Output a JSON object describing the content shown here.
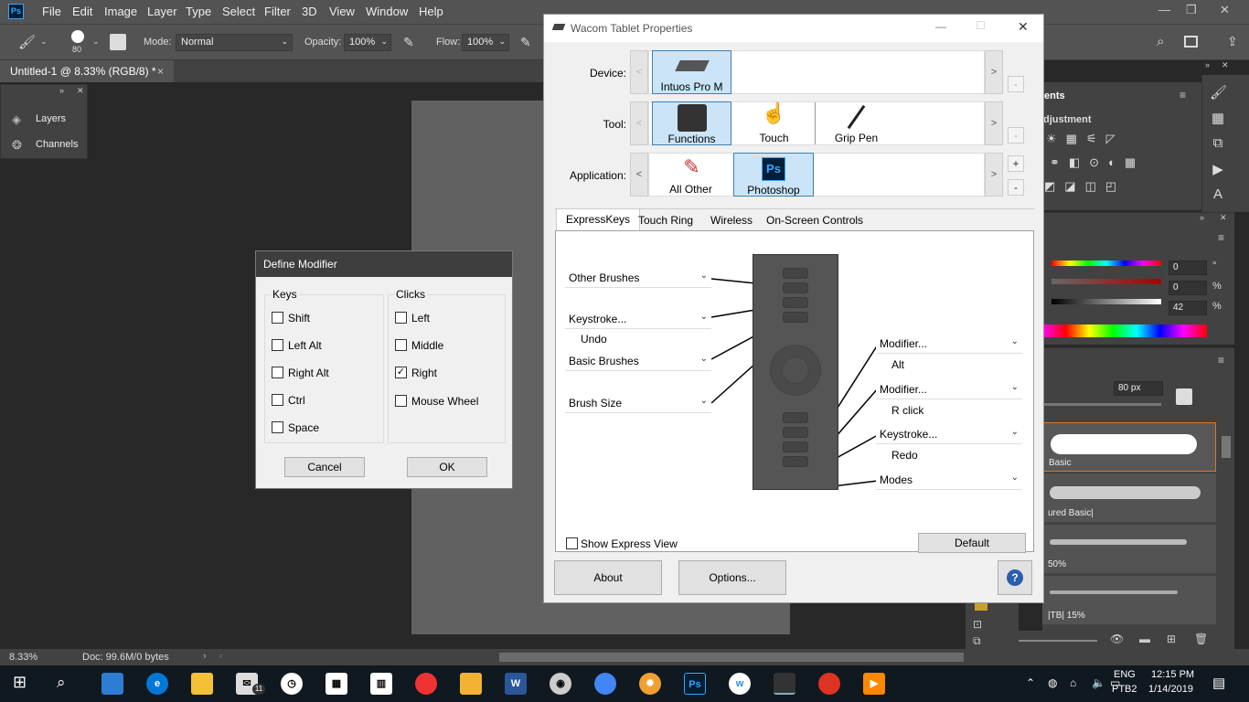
{
  "photoshop": {
    "menu": [
      "File",
      "Edit",
      "Image",
      "Layer",
      "Type",
      "Select",
      "Filter",
      "3D",
      "View",
      "Window",
      "Help"
    ],
    "logo": "Ps",
    "options": {
      "brush_size": "80",
      "mode_label": "Mode:",
      "mode_value": "Normal",
      "opacity_label": "Opacity:",
      "opacity_value": "100%",
      "flow_label": "Flow:",
      "flow_value": "100%"
    },
    "doc_tab": "Untitled-1 @ 8.33% (RGB/8) *",
    "doc_tab_close": "×",
    "left_panel": {
      "layers": "Layers",
      "channels": "Channels"
    },
    "status": {
      "zoom": "8.33%",
      "doc": "Doc: 99.6M/0 bytes"
    },
    "right_panels": {
      "tab_partial": "ents",
      "adjustments_partial": "djustment",
      "color_values": [
        "0",
        "0",
        "42"
      ],
      "color_units": [
        "°",
        "%",
        "%"
      ],
      "brush_size": "80 px",
      "brushes": [
        "Basic",
        "ured Basic|",
        "50%",
        "|TB| 15%"
      ]
    }
  },
  "define_modifier": {
    "title": "Define Modifier",
    "keys_label": "Keys",
    "keys": [
      {
        "label": "Shift",
        "checked": false
      },
      {
        "label": "Left Alt",
        "checked": false
      },
      {
        "label": "Right Alt",
        "checked": false
      },
      {
        "label": "Ctrl",
        "checked": false
      },
      {
        "label": "Space",
        "checked": false
      }
    ],
    "clicks_label": "Clicks",
    "clicks": [
      {
        "label": "Left",
        "checked": false
      },
      {
        "label": "Middle",
        "checked": false
      },
      {
        "label": "Right",
        "checked": true
      },
      {
        "label": "Mouse Wheel",
        "checked": false
      }
    ],
    "cancel": "Cancel",
    "ok": "OK"
  },
  "wacom": {
    "title": "Wacom Tablet Properties",
    "device_label": "Device:",
    "device": "Intuos Pro M",
    "tool_label": "Tool:",
    "tools": [
      "Functions",
      "Touch",
      "Grip Pen"
    ],
    "application_label": "Application:",
    "applications": [
      "All Other",
      "Photoshop"
    ],
    "ps_icon": "Ps",
    "nav_prev": "<",
    "nav_next": ">",
    "plus": "+",
    "minus": "-",
    "tabs": [
      "ExpressKeys",
      "Touch Ring",
      "Wireless",
      "On-Screen Controls"
    ],
    "left_keys": [
      {
        "value": "Other Brushes",
        "sub": ""
      },
      {
        "value": "Keystroke...",
        "sub": "Undo"
      },
      {
        "value": "Basic Brushes",
        "sub": ""
      },
      {
        "value": "Brush Size",
        "sub": ""
      }
    ],
    "right_keys": [
      {
        "value": "Modifier...",
        "sub": "Alt"
      },
      {
        "value": "Modifier...",
        "sub": "R click"
      },
      {
        "value": "Keystroke...",
        "sub": "Redo"
      },
      {
        "value": "Modes",
        "sub": ""
      }
    ],
    "show_express_view": "Show Express View",
    "default_btn": "Default",
    "about_btn": "About",
    "options_btn": "Options...",
    "help_icon": "?"
  },
  "taskbar": {
    "language": "ENG",
    "layout": "PTB2",
    "time": "12:15 PM",
    "date": "1/14/2019",
    "mail_badge": "11",
    "ps_label": "Ps",
    "word_label": "W"
  }
}
